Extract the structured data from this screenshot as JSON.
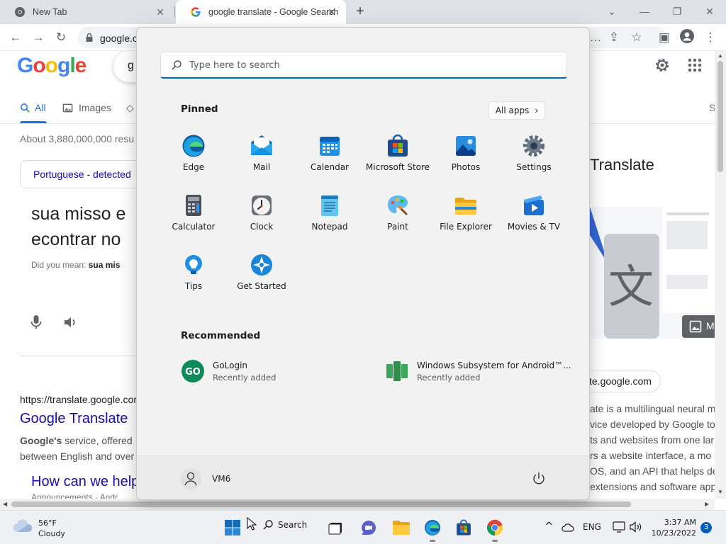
{
  "browser": {
    "tabs": [
      {
        "title": "New Tab",
        "active": false
      },
      {
        "title": "google translate - Google Search",
        "active": true
      }
    ],
    "url": "google.c"
  },
  "google": {
    "logo": "Google",
    "query_partial": "g",
    "tabs": [
      "All",
      "Images"
    ],
    "stats": "About 3,880,000,000 resu",
    "detected_language": "Portuguese - detected",
    "source_text": "sua misso e econtrar no",
    "did_you_mean_prefix": "Did you mean:",
    "did_you_mean_value": "sua mis",
    "result1": {
      "url": "https://translate.google.com",
      "title": "Google Translate",
      "snippet_bold": "Google's",
      "snippet_rest": " service, offered",
      "snippet_line2": "between English and over"
    },
    "result2": {
      "title": "How can we help",
      "sub": "Announcements · Andr"
    },
    "knowledge_panel": {
      "title": "Translate",
      "site_chip": "te.google.com",
      "image_button_label": "M",
      "description_lines": [
        "ate is a multilingual neural m",
        "vice developed by Google to",
        "ts and websites from one lar",
        "rs a website interface, a mo",
        "OS, and an API that helps de",
        "extensions and software app"
      ]
    },
    "right_edge_tab": "S"
  },
  "start_menu": {
    "search_placeholder": "Type here to search",
    "pinned_label": "Pinned",
    "all_apps_label": "All apps",
    "pinned_apps": [
      {
        "name": "Edge",
        "icon": "edge-icon"
      },
      {
        "name": "Mail",
        "icon": "mail-icon"
      },
      {
        "name": "Calendar",
        "icon": "calendar-icon"
      },
      {
        "name": "Microsoft Store",
        "icon": "store-icon"
      },
      {
        "name": "Photos",
        "icon": "photos-icon"
      },
      {
        "name": "Settings",
        "icon": "settings-icon"
      },
      {
        "name": "Calculator",
        "icon": "calculator-icon"
      },
      {
        "name": "Clock",
        "icon": "clock-icon"
      },
      {
        "name": "Notepad",
        "icon": "notepad-icon"
      },
      {
        "name": "Paint",
        "icon": "paint-icon"
      },
      {
        "name": "File Explorer",
        "icon": "folder-icon"
      },
      {
        "name": "Movies & TV",
        "icon": "movies-icon"
      },
      {
        "name": "Tips",
        "icon": "tips-icon"
      },
      {
        "name": "Get Started",
        "icon": "get-started-icon"
      }
    ],
    "recommended_label": "Recommended",
    "recommended": [
      {
        "name": "GoLogin",
        "sub": "Recently added",
        "icon": "gologin-icon"
      },
      {
        "name": "Windows Subsystem for Android™...",
        "sub": "Recently added",
        "icon": "wsa-icon"
      }
    ],
    "user_name": "VM6"
  },
  "taskbar": {
    "weather_temp": "56°F",
    "weather_desc": "Cloudy",
    "search_label": "Search",
    "language": "ENG",
    "time": "3:37 AM",
    "date": "10/23/2022",
    "notification_count": "3"
  },
  "colors": {
    "accent": "#0067c0",
    "google_link": "#1a0dab",
    "google_blue": "#1a73e8"
  }
}
